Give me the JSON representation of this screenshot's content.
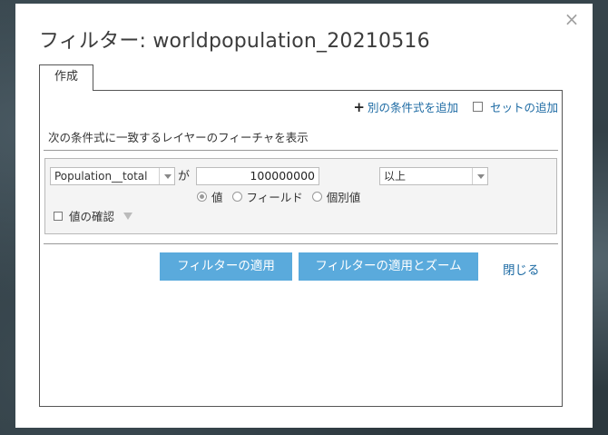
{
  "dialog": {
    "title": "フィルター: worldpopulation_20210516",
    "close_glyph": "×"
  },
  "tabs": [
    {
      "label": "作成"
    }
  ],
  "actions": {
    "add_expression": "別の条件式を追加",
    "add_set": "セットの追加"
  },
  "description": "次の条件式に一致するレイヤーのフィーチャを表示",
  "condition": {
    "field": "Population__total",
    "connector": "が",
    "value": "100000000",
    "operator": "以上",
    "value_types": [
      {
        "label": "値",
        "selected": true
      },
      {
        "label": "フィールド",
        "selected": false
      },
      {
        "label": "個別値",
        "selected": false
      }
    ],
    "confirm_label": "値の確認"
  },
  "buttons": {
    "apply": "フィルターの適用",
    "apply_zoom": "フィルターの適用とズーム",
    "close": "閉じる"
  },
  "colors": {
    "primary_button": "#5aaadc",
    "link": "#1c6aa3"
  }
}
